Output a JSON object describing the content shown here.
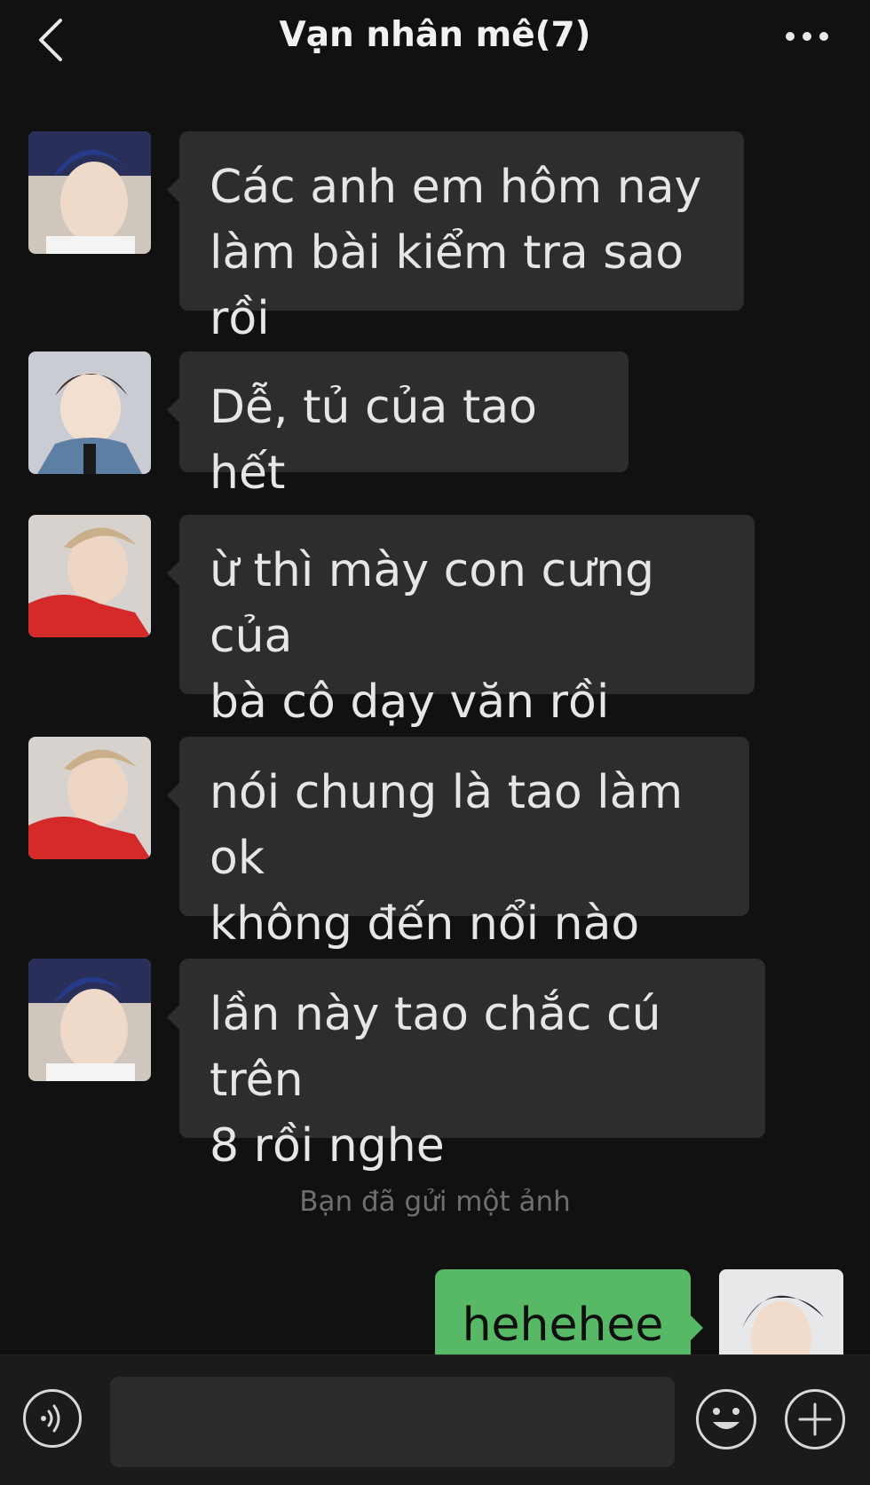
{
  "header": {
    "back_icon": "chevron-left-icon",
    "title": "Vạn nhân mê(7)",
    "more_icon": "ellipsis-icon"
  },
  "messages": [
    {
      "sender": "incoming",
      "avatar": "avatar-blue-hair",
      "text_lines": [
        "Các anh em hôm nay",
        "làm bài kiểm tra sao rồi"
      ]
    },
    {
      "sender": "incoming",
      "avatar": "avatar-denim-jacket",
      "text_lines": [
        "Dễ, tủ của tao hết"
      ]
    },
    {
      "sender": "incoming",
      "avatar": "avatar-red-hoodie",
      "text_lines": [
        "ừ thì mày con cưng của",
        "bà cô dạy văn rồi"
      ]
    },
    {
      "sender": "incoming",
      "avatar": "avatar-red-hoodie",
      "text_lines": [
        "nói chung là tao làm ok",
        "không đến nổi nào"
      ]
    },
    {
      "sender": "incoming",
      "avatar": "avatar-blue-hair",
      "text_lines": [
        "lần này tao chắc cú trên",
        "8 rồi nghe"
      ]
    }
  ],
  "system_notice": "Bạn đã gửi một ảnh",
  "own_message": {
    "text": "hehehee",
    "avatar": "avatar-self"
  },
  "composer": {
    "voice_icon": "voice-icon",
    "input_value": "",
    "emoji_icon": "emoji-icon",
    "plus_icon": "plus-icon"
  },
  "colors": {
    "background": "#111111",
    "incoming_bubble": "#2d2d2d",
    "outgoing_bubble": "#57b865",
    "system_text": "#6f6f6f"
  }
}
